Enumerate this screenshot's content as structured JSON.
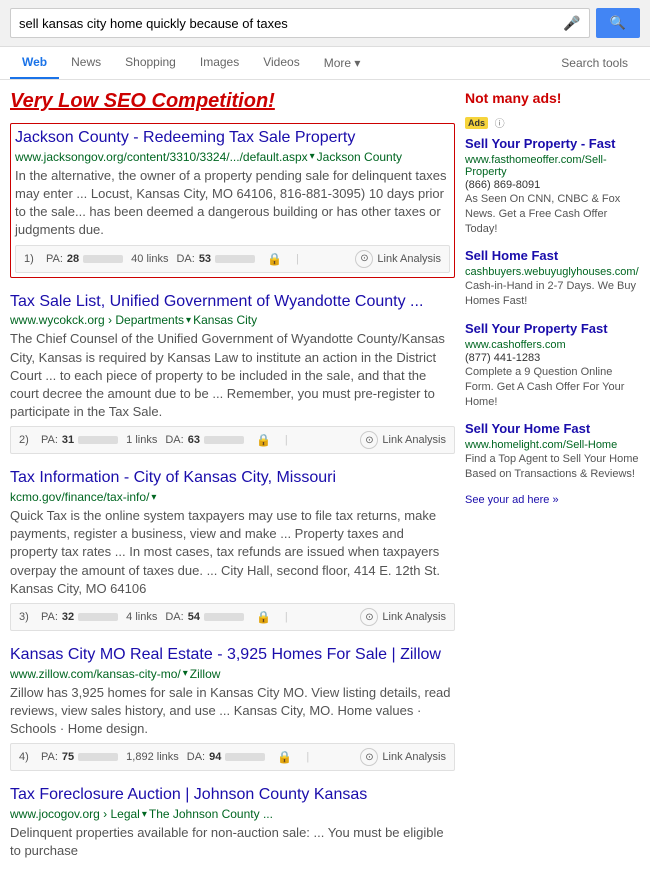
{
  "search": {
    "query": "sell kansas city home quickly because of taxes",
    "mic_label": "mic",
    "search_button_label": "🔍"
  },
  "nav": {
    "tabs": [
      "Web",
      "News",
      "Shopping",
      "Images",
      "Videos",
      "More",
      "Search tools"
    ],
    "active_tab": "Web",
    "more_label": "More",
    "search_tools_label": "Search tools"
  },
  "left": {
    "seo_label": "Very Low SEO Competition!",
    "results": [
      {
        "id": 1,
        "title": "Jackson County - Redeeming Tax Sale Property",
        "url_display": "www.jacksongov.org/content/3310/3324/.../default.aspx",
        "url_sub": "Jackson County",
        "snippet": "In the alternative, the owner of a property pending sale for delinquent taxes may enter ... Locust, Kansas City, MO 64106, 816-881-3095) 10 days prior to the sale... has been deemed a dangerous building or has other taxes or judgments due.",
        "highlight": true,
        "seo": {
          "num": "1)",
          "pa_label": "PA:",
          "pa_val": "28",
          "pa_pct": 28,
          "links_count": "40 links",
          "da_label": "DA:",
          "da_val": "53",
          "da_pct": 53,
          "link_analysis_label": "Link Analysis"
        }
      },
      {
        "id": 2,
        "title": "Tax Sale List, Unified Government of Wyandotte County ...",
        "url_display": "www.wycokck.org › Departments",
        "url_sub": "Kansas City",
        "snippet": "The Chief Counsel of the Unified Government of Wyandotte County/Kansas City, Kansas is required by Kansas Law to institute an action in the District Court ... to each piece of property to be included in the sale, and that the court decree the amount due to be ... Remember, you must pre-register to participate in the Tax Sale.",
        "highlight": false,
        "seo": {
          "num": "2)",
          "pa_label": "PA:",
          "pa_val": "31",
          "pa_pct": 31,
          "links_count": "1 links",
          "da_label": "DA:",
          "da_val": "63",
          "da_pct": 63,
          "link_analysis_label": "Link Analysis"
        }
      },
      {
        "id": 3,
        "title": "Tax Information - City of Kansas City, Missouri",
        "url_display": "kcmo.gov/finance/tax-info/",
        "url_sub": "",
        "snippet": "Quick Tax is the online system taxpayers may use to file tax returns, make payments, register a business, view and make ... Property taxes and property tax rates ... In most cases, tax refunds are issued when taxpayers overpay the amount of taxes due. ... City Hall, second floor, 414 E. 12th St. Kansas City, MO 64106",
        "highlight": false,
        "seo": {
          "num": "3)",
          "pa_label": "PA:",
          "pa_val": "32",
          "pa_pct": 32,
          "links_count": "4 links",
          "da_label": "DA:",
          "da_val": "54",
          "da_pct": 54,
          "link_analysis_label": "Link Analysis"
        }
      },
      {
        "id": 4,
        "title": "Kansas City MO Real Estate - 3,925 Homes For Sale | Zillow",
        "url_display": "www.zillow.com/kansas-city-mo/",
        "url_sub": "Zillow",
        "snippet": "Zillow has 3,925 homes for sale in Kansas City MO. View listing details, read reviews, view sales history, and use ... Kansas City, MO. Home values · Schools · Home design.",
        "highlight": false,
        "seo": {
          "num": "4)",
          "pa_label": "PA:",
          "pa_val": "75",
          "pa_pct": 75,
          "links_count": "1,892 links",
          "da_label": "DA:",
          "da_val": "94",
          "da_pct": 94,
          "link_analysis_label": "Link Analysis"
        }
      },
      {
        "id": 5,
        "title": "Tax Foreclosure Auction | Johnson County Kansas",
        "url_display": "www.jocogov.org › Legal",
        "url_sub": "The Johnson County ...",
        "snippet": "Delinquent properties available for non-auction sale: ... You must be eligible to purchase",
        "highlight": false,
        "seo": null
      }
    ]
  },
  "right": {
    "label": "Not many ads!",
    "ads_badge_label": "Ads",
    "ads": [
      {
        "title": "Sell Your Property - Fast",
        "url": "www.fasthomeoffer.com/Sell-Property",
        "phone": "(866) 869-8091",
        "snippet": "As Seen On CNN, CNBC & Fox News. Get a Free Cash Offer Today!"
      },
      {
        "title": "Sell Home Fast",
        "url": "cashbuyers.webuyuglyhouses.com/",
        "phone": "",
        "snippet": "Cash-in-Hand in 2-7 Days. We Buy Homes Fast!"
      },
      {
        "title": "Sell Your Property Fast",
        "url": "www.cashoffers.com",
        "phone": "(877) 441-1283",
        "snippet": "Complete a 9 Question Online Form. Get A Cash Offer For Your Home!"
      },
      {
        "title": "Sell Your Home Fast",
        "url": "www.homelight.com/Sell-Home",
        "phone": "",
        "snippet": "Find a Top Agent to Sell Your Home Based on Transactions & Reviews!"
      }
    ],
    "see_your_ad": "See your ad here »"
  }
}
